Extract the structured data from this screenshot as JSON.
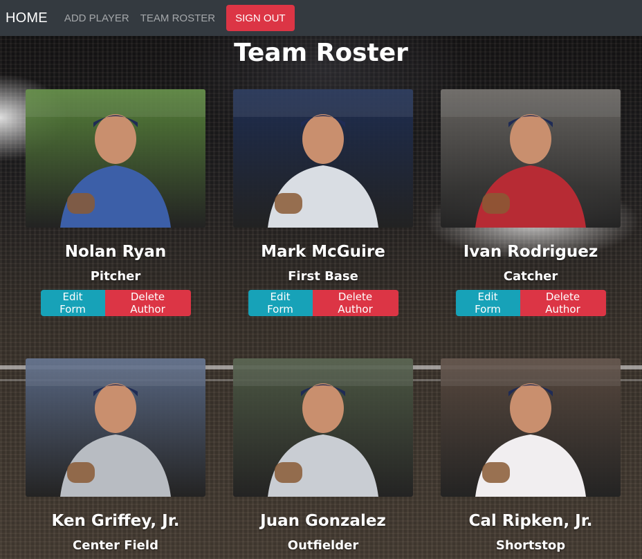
{
  "nav": {
    "brand": "HOME",
    "links": [
      "ADD PLAYER",
      "TEAM ROSTER"
    ],
    "signout": "SIGN OUT"
  },
  "title": "Team Roster",
  "buttons": {
    "edit": "Edit Form",
    "delete": "Delete Author"
  },
  "players": [
    {
      "name": "Nolan Ryan",
      "position": "Pitcher",
      "jersey": "#3c5fa8",
      "bg": "#5b8a3c"
    },
    {
      "name": "Mark McGuire",
      "position": "First Base",
      "jersey": "#d9dde3",
      "bg": "#1d2e55"
    },
    {
      "name": "Ivan Rodriguez",
      "position": "Catcher",
      "jersey": "#b72b34",
      "bg": "#6d6a66"
    },
    {
      "name": "Ken Griffey, Jr.",
      "position": "Center Field",
      "jersey": "#b8bcc2",
      "bg": "#5a6b8a"
    },
    {
      "name": "Juan Gonzalez",
      "position": "Outfielder",
      "jersey": "#c9cdd3",
      "bg": "#4d5a45"
    },
    {
      "name": "Cal Ripken, Jr.",
      "position": "Shortstop",
      "jersey": "#f1eef0",
      "bg": "#5a4a40"
    }
  ],
  "colors": {
    "navbar": "#343a40",
    "danger": "#dc3545",
    "info": "#17a2b8"
  }
}
